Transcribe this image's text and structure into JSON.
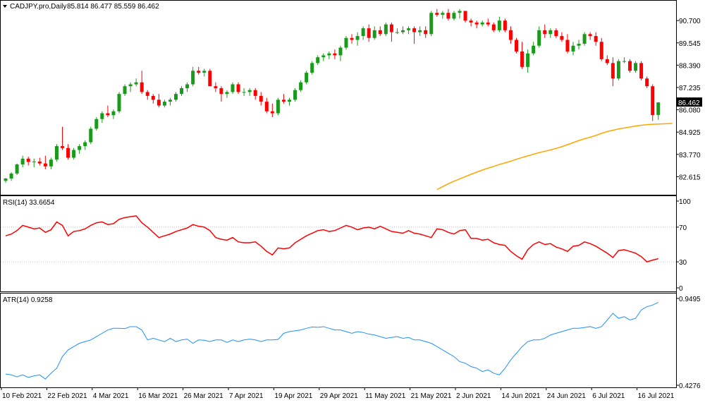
{
  "header": {
    "symbol_label": "CADJPY.pro,Daily",
    "ohlc_label": "85.814 86.477 85.559 86.462"
  },
  "current_price_label": "86.462",
  "colors": {
    "bull": "#1a9a1a",
    "bear": "#ff0000",
    "ma": "#ffa500",
    "rsi": "#ff0000",
    "atr": "#1e90ff",
    "border": "#000000",
    "grid": "#c0c0c0"
  },
  "chart_data": [
    {
      "type": "candlestick",
      "title": "CADJPY.pro,Daily",
      "ylim": [
        81.9,
        91.4
      ],
      "y_ticks": [
        "90.700",
        "89.545",
        "88.390",
        "87.235",
        "86.080",
        "84.925",
        "83.770",
        "82.615"
      ],
      "y_tick_values": [
        90.7,
        89.545,
        88.39,
        87.235,
        86.08,
        84.925,
        83.77,
        82.615
      ],
      "x_ticks": [
        "10 Feb 2021",
        "22 Feb 2021",
        "4 Mar 2021",
        "16 Mar 2021",
        "26 Mar 2021",
        "7 Apr 2021",
        "19 Apr 2021",
        "29 Apr 2021",
        "11 May 2021",
        "21 May 2021",
        "2 Jun 2021",
        "14 Jun 2021",
        "24 Jun 2021",
        "6 Jul 2021",
        "16 Jul 2021"
      ],
      "x_tick_index": [
        0,
        8,
        16,
        24,
        32,
        40,
        48,
        56,
        64,
        72,
        80,
        88,
        96,
        104,
        112
      ],
      "ohlc": [
        [
          82.4,
          82.55,
          82.3,
          82.52
        ],
        [
          82.52,
          82.85,
          82.4,
          82.78
        ],
        [
          82.78,
          83.3,
          82.7,
          83.25
        ],
        [
          83.25,
          83.7,
          83.1,
          83.55
        ],
        [
          83.55,
          83.65,
          83.2,
          83.38
        ],
        [
          83.38,
          83.55,
          83.1,
          83.4
        ],
        [
          83.4,
          83.6,
          83.2,
          83.3
        ],
        [
          83.3,
          83.7,
          83.0,
          83.15
        ],
        [
          83.15,
          83.6,
          83.0,
          83.5
        ],
        [
          83.5,
          84.3,
          83.4,
          84.2
        ],
        [
          84.2,
          85.2,
          84.0,
          84.1
        ],
        [
          84.1,
          84.3,
          83.5,
          83.6
        ],
        [
          83.6,
          84.1,
          83.5,
          84.0
        ],
        [
          84.0,
          84.3,
          83.8,
          84.2
        ],
        [
          84.2,
          84.5,
          84.0,
          84.4
        ],
        [
          84.4,
          85.2,
          84.3,
          85.1
        ],
        [
          85.1,
          85.7,
          85.0,
          85.6
        ],
        [
          85.6,
          86.0,
          85.4,
          85.9
        ],
        [
          85.9,
          86.3,
          85.7,
          85.8
        ],
        [
          85.8,
          86.1,
          85.6,
          86.0
        ],
        [
          86.0,
          87.0,
          85.9,
          86.9
        ],
        [
          86.9,
          87.4,
          86.8,
          87.3
        ],
        [
          87.3,
          87.5,
          87.0,
          87.4
        ],
        [
          87.4,
          87.7,
          87.3,
          87.5
        ],
        [
          87.5,
          88.1,
          86.9,
          87.0
        ],
        [
          87.0,
          87.1,
          86.6,
          86.8
        ],
        [
          86.8,
          86.9,
          86.4,
          86.6
        ],
        [
          86.6,
          86.9,
          86.2,
          86.3
        ],
        [
          86.3,
          86.6,
          86.2,
          86.5
        ],
        [
          86.5,
          86.7,
          86.3,
          86.6
        ],
        [
          86.6,
          87.0,
          86.5,
          86.9
        ],
        [
          86.9,
          87.3,
          86.8,
          87.2
        ],
        [
          87.2,
          87.5,
          87.0,
          87.4
        ],
        [
          87.4,
          88.3,
          87.3,
          88.1
        ],
        [
          88.1,
          88.3,
          87.9,
          88.0
        ],
        [
          88.0,
          88.2,
          87.8,
          88.1
        ],
        [
          88.1,
          88.2,
          87.4,
          87.3
        ],
        [
          87.3,
          87.5,
          87.0,
          87.2
        ],
        [
          87.2,
          87.3,
          86.5,
          86.9
        ],
        [
          86.9,
          87.1,
          86.7,
          87.0
        ],
        [
          87.0,
          87.5,
          86.9,
          87.4
        ],
        [
          87.4,
          87.5,
          86.9,
          87.0
        ],
        [
          87.0,
          87.2,
          86.8,
          87.0
        ],
        [
          87.0,
          87.2,
          86.8,
          87.1
        ],
        [
          87.1,
          87.2,
          86.6,
          86.8
        ],
        [
          86.8,
          87.0,
          86.3,
          86.5
        ],
        [
          86.5,
          86.7,
          85.9,
          86.0
        ],
        [
          86.0,
          86.4,
          85.7,
          85.9
        ],
        [
          85.9,
          86.7,
          85.8,
          86.6
        ],
        [
          86.6,
          86.9,
          86.4,
          86.5
        ],
        [
          86.5,
          86.7,
          86.3,
          86.6
        ],
        [
          86.6,
          87.2,
          86.5,
          87.1
        ],
        [
          87.1,
          87.6,
          87.0,
          87.5
        ],
        [
          87.5,
          88.1,
          87.4,
          88.0
        ],
        [
          88.0,
          88.6,
          87.9,
          88.5
        ],
        [
          88.5,
          88.9,
          88.4,
          88.8
        ],
        [
          88.8,
          89.0,
          88.6,
          88.9
        ],
        [
          88.9,
          89.1,
          88.7,
          89.0
        ],
        [
          89.0,
          89.2,
          88.7,
          88.9
        ],
        [
          88.9,
          89.4,
          88.6,
          89.3
        ],
        [
          89.3,
          89.9,
          89.2,
          89.8
        ],
        [
          89.8,
          90.0,
          89.5,
          89.7
        ],
        [
          89.7,
          90.1,
          89.4,
          89.9
        ],
        [
          89.9,
          90.4,
          89.7,
          90.3
        ],
        [
          90.3,
          90.5,
          89.6,
          89.8
        ],
        [
          89.8,
          90.4,
          89.7,
          90.2
        ],
        [
          90.2,
          90.4,
          89.9,
          90.0
        ],
        [
          90.0,
          90.6,
          89.9,
          90.5
        ],
        [
          90.5,
          90.6,
          89.6,
          90.1
        ],
        [
          90.1,
          90.3,
          90.0,
          90.1
        ],
        [
          90.1,
          90.4,
          90.0,
          90.2
        ],
        [
          90.2,
          90.4,
          90.0,
          90.3
        ],
        [
          90.3,
          90.4,
          89.5,
          90.1
        ],
        [
          90.1,
          90.4,
          89.9,
          90.2
        ],
        [
          90.2,
          90.4,
          89.8,
          90.0
        ],
        [
          90.0,
          91.2,
          89.9,
          91.1
        ],
        [
          91.1,
          91.3,
          90.9,
          91.0
        ],
        [
          91.0,
          91.2,
          90.8,
          91.1
        ],
        [
          91.1,
          91.3,
          90.7,
          90.8
        ],
        [
          90.8,
          91.2,
          90.7,
          91.1
        ],
        [
          91.1,
          91.3,
          90.8,
          91.2
        ],
        [
          91.2,
          91.2,
          90.6,
          90.7
        ],
        [
          90.7,
          90.8,
          90.4,
          90.6
        ],
        [
          90.6,
          90.7,
          90.3,
          90.5
        ],
        [
          90.5,
          90.7,
          90.4,
          90.6
        ],
        [
          90.6,
          90.8,
          90.4,
          90.5
        ],
        [
          90.5,
          90.6,
          90.1,
          90.2
        ],
        [
          90.2,
          90.9,
          90.1,
          90.7
        ],
        [
          90.7,
          90.8,
          90.1,
          90.2
        ],
        [
          90.2,
          90.4,
          89.5,
          89.7
        ],
        [
          89.7,
          89.8,
          89.0,
          89.1
        ],
        [
          89.1,
          89.6,
          88.2,
          88.3
        ],
        [
          88.3,
          89.2,
          88.0,
          89.0
        ],
        [
          89.0,
          89.6,
          88.9,
          89.4
        ],
        [
          89.4,
          90.4,
          89.3,
          90.2
        ],
        [
          90.2,
          90.5,
          89.8,
          90.0
        ],
        [
          90.0,
          90.3,
          89.8,
          90.2
        ],
        [
          90.2,
          90.3,
          89.8,
          89.9
        ],
        [
          89.9,
          90.1,
          89.6,
          89.7
        ],
        [
          89.7,
          90.0,
          89.0,
          89.1
        ],
        [
          89.1,
          89.6,
          88.9,
          89.4
        ],
        [
          89.4,
          89.7,
          89.2,
          89.5
        ],
        [
          89.5,
          90.1,
          89.4,
          90.0
        ],
        [
          90.0,
          90.1,
          89.7,
          89.9
        ],
        [
          89.9,
          90.1,
          89.4,
          89.6
        ],
        [
          89.6,
          89.8,
          88.6,
          88.7
        ],
        [
          88.7,
          88.9,
          88.4,
          88.5
        ],
        [
          88.5,
          88.8,
          87.3,
          87.7
        ],
        [
          87.7,
          88.7,
          87.6,
          88.6
        ],
        [
          88.6,
          88.8,
          88.5,
          88.6
        ],
        [
          88.6,
          88.7,
          88.0,
          88.1
        ],
        [
          88.1,
          88.6,
          88.0,
          88.5
        ],
        [
          88.5,
          88.6,
          87.6,
          87.7
        ],
        [
          87.7,
          87.8,
          87.2,
          87.3
        ],
        [
          87.3,
          87.4,
          85.5,
          85.81
        ],
        [
          85.814,
          86.477,
          85.559,
          86.462
        ]
      ],
      "ma_line": {
        "start_index": 76,
        "values": [
          81.95,
          82.1,
          82.25,
          82.38,
          82.5,
          82.62,
          82.74,
          82.85,
          82.96,
          83.06,
          83.15,
          83.25,
          83.33,
          83.42,
          83.52,
          83.61,
          83.69,
          83.78,
          83.86,
          83.93,
          84.0,
          84.08,
          84.17,
          84.27,
          84.38,
          84.49,
          84.58,
          84.66,
          84.75,
          84.86,
          84.95,
          85.02,
          85.09,
          85.14,
          85.19,
          85.24,
          85.28,
          85.31,
          85.33,
          85.37
        ],
        "step": 1
      }
    },
    {
      "type": "line",
      "title": "RSI(14) 33.6654",
      "ylim": [
        0,
        100
      ],
      "y_ticks": [
        "100",
        "70",
        "30",
        "0"
      ],
      "y_tick_values": [
        100,
        70,
        30,
        0
      ],
      "series": [
        {
          "name": "RSI(14)",
          "values": [
            60,
            62,
            66,
            72,
            70,
            68,
            69,
            64,
            67,
            76,
            72,
            60,
            65,
            66,
            68,
            72,
            75,
            76,
            73,
            74,
            79,
            81,
            82,
            83,
            75,
            70,
            64,
            58,
            60,
            62,
            65,
            67,
            69,
            73,
            71,
            70,
            66,
            58,
            56,
            55,
            58,
            53,
            52,
            52,
            53,
            48,
            42,
            38,
            46,
            45,
            46,
            52,
            56,
            60,
            63,
            66,
            67,
            65,
            66,
            69,
            72,
            70,
            67,
            69,
            70,
            68,
            71,
            68,
            65,
            64,
            63,
            66,
            63,
            62,
            60,
            58,
            68,
            67,
            64,
            62,
            66,
            67,
            57,
            57,
            55,
            56,
            52,
            50,
            49,
            42,
            37,
            33,
            44,
            50,
            53,
            50,
            51,
            47,
            45,
            42,
            48,
            49,
            53,
            51,
            48,
            44,
            40,
            35,
            43,
            44,
            42,
            40,
            36,
            30,
            32,
            33.6654
          ]
        }
      ]
    },
    {
      "type": "line",
      "title": "ATR(14) 0.9258",
      "ylim": [
        0.4276,
        0.9495
      ],
      "y_ticks": [
        "0.9495",
        "0.4276"
      ],
      "y_tick_values": [
        0.9495,
        0.4276
      ],
      "series": [
        {
          "name": "ATR(14)",
          "values": [
            0.495,
            0.49,
            0.478,
            0.49,
            0.475,
            0.484,
            0.49,
            0.465,
            0.5,
            0.53,
            0.6,
            0.64,
            0.66,
            0.68,
            0.69,
            0.7,
            0.72,
            0.74,
            0.76,
            0.77,
            0.77,
            0.768,
            0.78,
            0.78,
            0.76,
            0.7,
            0.71,
            0.7,
            0.69,
            0.71,
            0.69,
            0.7,
            0.705,
            0.68,
            0.7,
            0.698,
            0.69,
            0.7,
            0.7,
            0.685,
            0.7,
            0.69,
            0.7,
            0.705,
            0.7,
            0.69,
            0.7,
            0.7,
            0.703,
            0.74,
            0.75,
            0.755,
            0.76,
            0.77,
            0.778,
            0.776,
            0.78,
            0.77,
            0.76,
            0.76,
            0.75,
            0.74,
            0.75,
            0.745,
            0.735,
            0.73,
            0.72,
            0.71,
            0.715,
            0.72,
            0.71,
            0.715,
            0.7,
            0.7,
            0.69,
            0.68,
            0.66,
            0.64,
            0.62,
            0.6,
            0.57,
            0.56,
            0.54,
            0.53,
            0.51,
            0.52,
            0.5,
            0.49,
            0.53,
            0.58,
            0.62,
            0.66,
            0.69,
            0.7,
            0.7,
            0.71,
            0.73,
            0.74,
            0.75,
            0.76,
            0.77,
            0.77,
            0.775,
            0.78,
            0.77,
            0.78,
            0.82,
            0.86,
            0.83,
            0.84,
            0.82,
            0.83,
            0.88,
            0.9,
            0.91,
            0.9258
          ]
        }
      ]
    }
  ]
}
